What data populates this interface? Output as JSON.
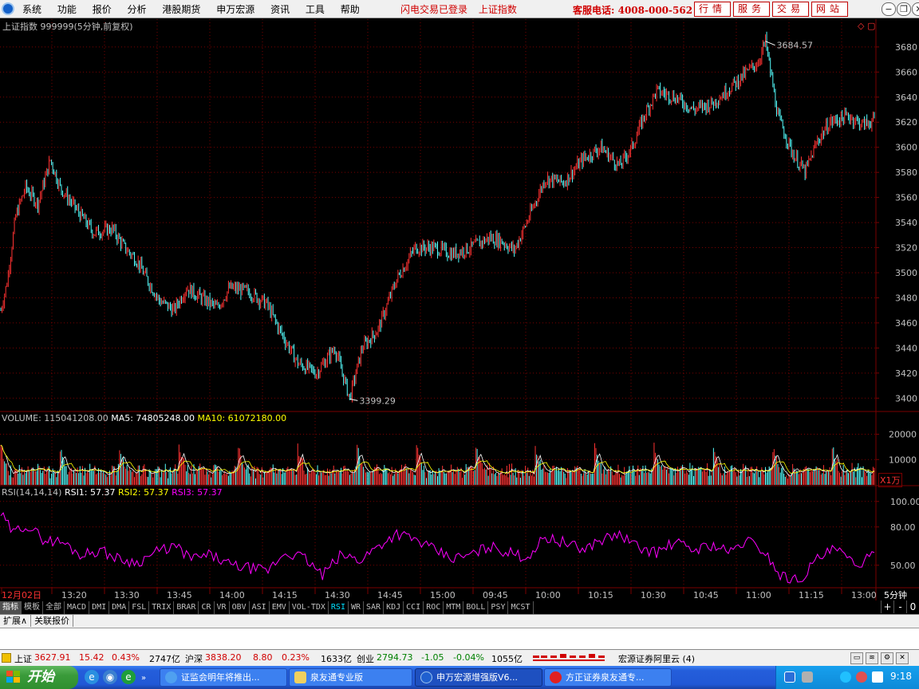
{
  "menubar": {
    "items": [
      "系统",
      "功能",
      "报价",
      "分析",
      "港股期货",
      "申万宏源",
      "资讯",
      "工具",
      "帮助"
    ],
    "flash_status": "闪电交易已登录",
    "index_name": "上证指数",
    "hotline": "客服电话: 4008-000-562",
    "buttons": [
      "行情",
      "服务",
      "交易",
      "网站"
    ]
  },
  "chart_header": "上证指数 999999(5分钟,前复权)",
  "colors": {
    "up": "#ff3232",
    "down": "#54fcfc",
    "grid": "#7a0000",
    "axis_text": "#c0c0c0",
    "rsi": "#ff00ff",
    "ma5": "#ffffff",
    "ma10": "#ffff00"
  },
  "chart_data": [
    {
      "type": "candlestick",
      "title": "上证指数 999999(5分钟,前复权)",
      "y_ticks": [
        3400,
        3420,
        3440,
        3460,
        3480,
        3500,
        3520,
        3540,
        3560,
        3580,
        3600,
        3620,
        3640,
        3660,
        3680
      ],
      "ylim": [
        3390,
        3692
      ],
      "annotations": [
        {
          "label": "3684.57",
          "value": 3684.57
        },
        {
          "label": "3399.29",
          "value": 3399.29
        }
      ],
      "close_path": [
        [
          0,
          3470
        ],
        [
          5,
          3492
        ],
        [
          12,
          3545
        ],
        [
          20,
          3568
        ],
        [
          30,
          3555
        ],
        [
          40,
          3590
        ],
        [
          48,
          3568
        ],
        [
          60,
          3552
        ],
        [
          75,
          3532
        ],
        [
          90,
          3535
        ],
        [
          100,
          3520
        ],
        [
          110,
          3510
        ],
        [
          118,
          3495
        ],
        [
          128,
          3478
        ],
        [
          140,
          3470
        ],
        [
          150,
          3488
        ],
        [
          162,
          3480
        ],
        [
          175,
          3472
        ],
        [
          185,
          3488
        ],
        [
          200,
          3485
        ],
        [
          215,
          3475
        ],
        [
          225,
          3455
        ],
        [
          240,
          3428
        ],
        [
          255,
          3420
        ],
        [
          270,
          3440
        ],
        [
          282,
          3400
        ],
        [
          292,
          3440
        ],
        [
          305,
          3455
        ],
        [
          320,
          3495
        ],
        [
          335,
          3520
        ],
        [
          350,
          3520
        ],
        [
          365,
          3515
        ],
        [
          380,
          3520
        ],
        [
          395,
          3528
        ],
        [
          405,
          3525
        ],
        [
          415,
          3518
        ],
        [
          425,
          3540
        ],
        [
          440,
          3575
        ],
        [
          455,
          3572
        ],
        [
          470,
          3590
        ],
        [
          485,
          3600
        ],
        [
          500,
          3585
        ],
        [
          510,
          3600
        ],
        [
          520,
          3625
        ],
        [
          530,
          3645
        ],
        [
          545,
          3640
        ],
        [
          560,
          3630
        ],
        [
          575,
          3635
        ],
        [
          590,
          3648
        ],
        [
          603,
          3660
        ],
        [
          612,
          3668
        ],
        [
          618,
          3684.57
        ],
        [
          628,
          3625
        ],
        [
          640,
          3595
        ],
        [
          650,
          3580
        ],
        [
          660,
          3605
        ],
        [
          670,
          3620
        ],
        [
          685,
          3625
        ],
        [
          697,
          3618
        ],
        [
          706,
          3622
        ]
      ]
    },
    {
      "type": "bar",
      "title": "VOLUME",
      "legend": [
        "VOLUME: 115041208.00",
        "MA5: 74805248.00",
        "MA10: 61072180.00"
      ],
      "y_ticks": [
        10000,
        20000
      ],
      "ylim": [
        0,
        23000
      ],
      "unit": "X1万"
    },
    {
      "type": "line",
      "title": "RSI(14,14,14)",
      "legend": [
        "RSI(14,14,14)",
        "RSI1: 57.37",
        "RSI2: 57.37",
        "RSI3: 57.37"
      ],
      "y_ticks": [
        50.0,
        80.0,
        100.0
      ],
      "ylim": [
        33,
        108
      ],
      "x_labels": [
        "12月02日",
        "13:20",
        "13:30",
        "13:45",
        "14:00",
        "14:15",
        "14:30",
        "14:45",
        "15:00",
        "09:45",
        "10:00",
        "10:15",
        "10:30",
        "10:45",
        "11:00",
        "11:15",
        "13:00"
      ],
      "period": "5分钟",
      "path": [
        [
          0,
          90
        ],
        [
          10,
          75
        ],
        [
          20,
          82
        ],
        [
          35,
          70
        ],
        [
          50,
          68
        ],
        [
          65,
          58
        ],
        [
          80,
          62
        ],
        [
          95,
          55
        ],
        [
          110,
          52
        ],
        [
          125,
          60
        ],
        [
          140,
          65
        ],
        [
          155,
          55
        ],
        [
          170,
          58
        ],
        [
          185,
          50
        ],
        [
          200,
          48
        ],
        [
          215,
          45
        ],
        [
          230,
          60
        ],
        [
          245,
          56
        ],
        [
          260,
          42
        ],
        [
          275,
          58
        ],
        [
          290,
          54
        ],
        [
          305,
          65
        ],
        [
          320,
          75
        ],
        [
          335,
          70
        ],
        [
          350,
          62
        ],
        [
          365,
          55
        ],
        [
          380,
          58
        ],
        [
          395,
          65
        ],
        [
          410,
          60
        ],
        [
          425,
          56
        ],
        [
          440,
          72
        ],
        [
          455,
          68
        ],
        [
          470,
          62
        ],
        [
          485,
          70
        ],
        [
          500,
          74
        ],
        [
          515,
          64
        ],
        [
          530,
          60
        ],
        [
          545,
          68
        ],
        [
          560,
          62
        ],
        [
          575,
          66
        ],
        [
          590,
          60
        ],
        [
          603,
          70
        ],
        [
          618,
          60
        ],
        [
          630,
          42
        ],
        [
          645,
          38
        ],
        [
          660,
          55
        ],
        [
          675,
          63
        ],
        [
          690,
          50
        ],
        [
          706,
          57
        ]
      ]
    }
  ],
  "indicators": [
    "指标",
    "模板",
    "全部",
    "MACD",
    "DMI",
    "DMA",
    "FSL",
    "TRIX",
    "BRAR",
    "CR",
    "VR",
    "OBV",
    "ASI",
    "EMV",
    "VOL-TDX",
    "RSI",
    "WR",
    "SAR",
    "KDJ",
    "CCI",
    "ROC",
    "MTM",
    "BOLL",
    "PSY",
    "MCST"
  ],
  "indicator_controls": [
    "+",
    "-",
    "0"
  ],
  "tabs": [
    "扩展∧",
    "关联报价"
  ],
  "status": {
    "sh": {
      "name": "上证",
      "value": "3627.91",
      "change": "15.42",
      "pct": "0.43%",
      "amount": "2747亿"
    },
    "hs": {
      "name": "沪深",
      "value": "3838.20",
      "change": "8.80",
      "pct": "0.23%",
      "amount": "1633亿"
    },
    "cy": {
      "name": "创业",
      "value": "2794.73",
      "change": "-1.05",
      "pct": "-0.04%",
      "amount": "1055亿"
    },
    "broker": "宏源证券阿里云 (4)"
  },
  "taskbar": {
    "start": "开始",
    "tasks": [
      "证监会明年将推出...",
      "泉友通专业版",
      "申万宏源增强版V6...",
      "方正证券泉友通专..."
    ],
    "clock": "9:18"
  }
}
